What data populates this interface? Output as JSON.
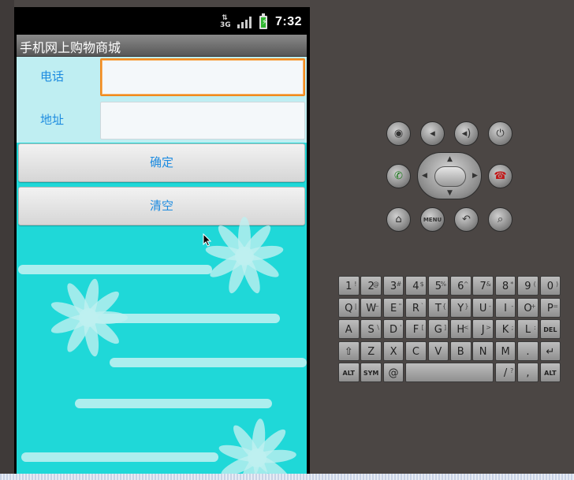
{
  "status_bar": {
    "network": "3G",
    "time": "7:32"
  },
  "app": {
    "title": "手机网上购物商城"
  },
  "form": {
    "phone_label": "电话",
    "phone_value": "",
    "address_label": "地址",
    "address_value": ""
  },
  "buttons": {
    "confirm": "确定",
    "clear": "清空"
  },
  "emulator": {
    "menu_label": "MENU",
    "keyboard_rows": [
      [
        {
          "k": "1",
          "s": "!"
        },
        {
          "k": "2",
          "s": "@"
        },
        {
          "k": "3",
          "s": "#"
        },
        {
          "k": "4",
          "s": "$"
        },
        {
          "k": "5",
          "s": "%"
        },
        {
          "k": "6",
          "s": "^"
        },
        {
          "k": "7",
          "s": "&"
        },
        {
          "k": "8",
          "s": "*"
        },
        {
          "k": "9",
          "s": "("
        },
        {
          "k": "0",
          "s": ")"
        }
      ],
      [
        {
          "k": "Q",
          "s": "|"
        },
        {
          "k": "W",
          "s": "~"
        },
        {
          "k": "E",
          "s": "\""
        },
        {
          "k": "R",
          "s": "`"
        },
        {
          "k": "T",
          "s": "{"
        },
        {
          "k": "Y",
          "s": "}"
        },
        {
          "k": "U",
          "s": "-"
        },
        {
          "k": "I",
          "s": "-"
        },
        {
          "k": "O",
          "s": "+"
        },
        {
          "k": "P",
          "s": "="
        }
      ],
      [
        {
          "k": "A",
          "s": ""
        },
        {
          "k": "S",
          "s": "\\"
        },
        {
          "k": "D",
          "s": "'"
        },
        {
          "k": "F",
          "s": "["
        },
        {
          "k": "G",
          "s": "]"
        },
        {
          "k": "H",
          "s": "<"
        },
        {
          "k": "J",
          "s": ">"
        },
        {
          "k": "K",
          "s": ";"
        },
        {
          "k": "L",
          "s": ":"
        },
        {
          "k": "DEL",
          "s": ""
        }
      ],
      [
        {
          "k": "⇧",
          "s": ""
        },
        {
          "k": "Z",
          "s": ""
        },
        {
          "k": "X",
          "s": ""
        },
        {
          "k": "C",
          "s": ""
        },
        {
          "k": "V",
          "s": ""
        },
        {
          "k": "B",
          "s": ""
        },
        {
          "k": "N",
          "s": ""
        },
        {
          "k": "M",
          "s": ""
        },
        {
          "k": ".",
          "s": ""
        },
        {
          "k": "↵",
          "s": ""
        }
      ],
      [
        {
          "k": "ALT",
          "s": ""
        },
        {
          "k": "SYM",
          "s": ""
        },
        {
          "k": "@",
          "s": ""
        },
        {
          "k": "",
          "s": ""
        },
        {
          "k": "/",
          "s": "?"
        },
        {
          "k": ",",
          "s": ""
        },
        {
          "k": "ALT",
          "s": ""
        }
      ]
    ]
  }
}
